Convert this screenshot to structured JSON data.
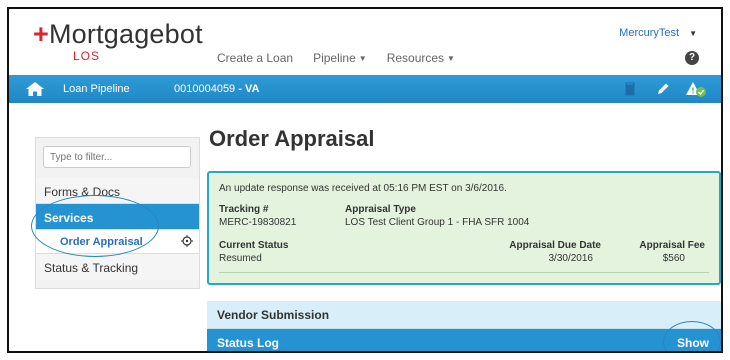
{
  "brand": {
    "name": "Mortgagebot",
    "plus": "+",
    "sub": "LOS"
  },
  "topnav": [
    {
      "label": "Create a Loan",
      "dropdown": false
    },
    {
      "label": "Pipeline",
      "dropdown": true
    },
    {
      "label": "Resources",
      "dropdown": true
    }
  ],
  "user": {
    "name": "MercuryTest"
  },
  "help_icon": "?",
  "bluebar": {
    "pipeline_label": "Loan Pipeline",
    "loan_number": "0010004059",
    "loan_suffix": " - VA"
  },
  "sidebar": {
    "filter_placeholder": "Type to filter...",
    "items": [
      {
        "label": "Forms & Docs"
      },
      {
        "label": "Services"
      },
      {
        "label": "Order Appraisal"
      },
      {
        "label": "Status & Tracking"
      }
    ]
  },
  "main": {
    "title": "Order Appraisal",
    "notice": "An update response was received at 05:16 PM EST on 3/6/2016.",
    "tracking_label": "Tracking #",
    "tracking_value": "MERC-19830821",
    "appraisal_type_label": "Appraisal Type",
    "appraisal_type_value": "LOS Test Client Group 1 - FHA SFR 1004",
    "current_status_label": "Current Status",
    "current_status_value": "Resumed",
    "due_date_label": "Appraisal Due Date",
    "due_date_value": "3/30/2016",
    "fee_label": "Appraisal Fee",
    "fee_value": "$560",
    "vendor_submission": "Vendor Submission",
    "status_log": "Status Log",
    "show": "Show"
  },
  "colors": {
    "accent": "#2593d2",
    "brand_red": "#d8262e",
    "info_bg": "#e3f3de",
    "info_border": "#2aa7c4"
  }
}
